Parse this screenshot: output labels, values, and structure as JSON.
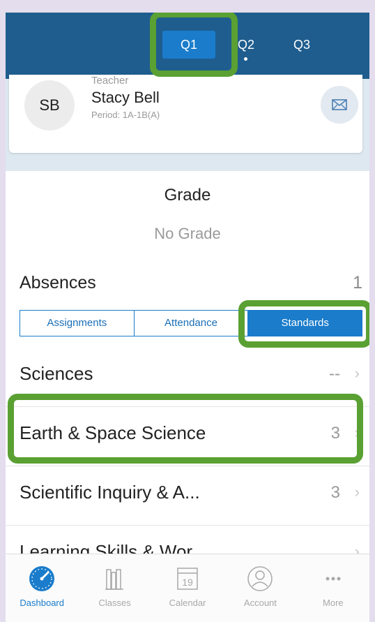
{
  "header": {
    "quarters": [
      {
        "label": "Q1",
        "active": true
      },
      {
        "label": "Q2",
        "active": false
      },
      {
        "label": "Q3",
        "active": false
      }
    ]
  },
  "teacher": {
    "initials": "SB",
    "role": "Teacher",
    "name": "Stacy Bell",
    "period": "Period: 1A-1B(A)",
    "mail_icon": "mail-icon"
  },
  "grade": {
    "title": "Grade",
    "value": "No Grade"
  },
  "absences": {
    "label": "Absences",
    "count": "1"
  },
  "segments": {
    "items": [
      "Assignments",
      "Attendance",
      "Standards"
    ],
    "selected": "Standards"
  },
  "standards": [
    {
      "label": "Sciences",
      "value": "--"
    },
    {
      "label": "Earth & Space Science",
      "value": "3"
    },
    {
      "label": "Scientific Inquiry & A...",
      "value": "3"
    },
    {
      "label": "Learning Skills & Wor...",
      "value": ""
    }
  ],
  "tabbar": {
    "items": [
      {
        "label": "Dashboard",
        "icon": "dashboard-icon",
        "active": true
      },
      {
        "label": "Classes",
        "icon": "books-icon",
        "active": false
      },
      {
        "label": "Calendar",
        "icon": "calendar-icon",
        "active": false,
        "day": "19"
      },
      {
        "label": "Account",
        "icon": "account-icon",
        "active": false
      },
      {
        "label": "More",
        "icon": "more-icon",
        "active": false
      }
    ]
  },
  "colors": {
    "header_bg": "#1f5d8e",
    "accent": "#1a7ccb",
    "highlight": "#5aa033"
  }
}
